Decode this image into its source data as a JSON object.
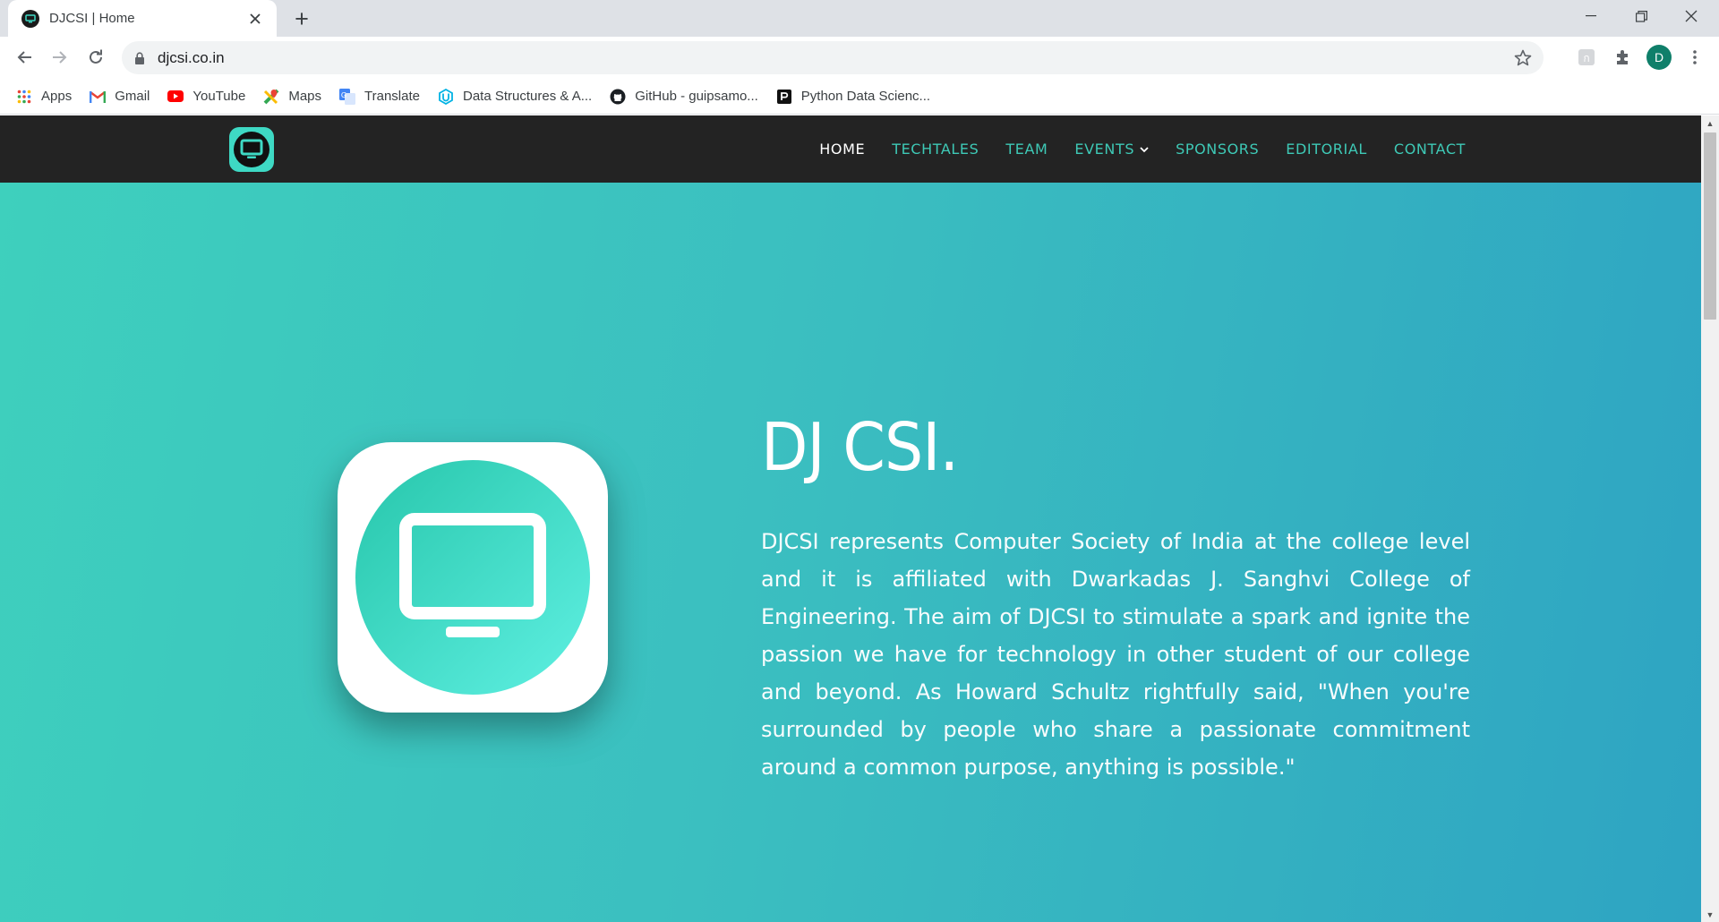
{
  "browser": {
    "tab": {
      "title": "DJCSI | Home",
      "close_glyph": "✕"
    },
    "new_tab_glyph": "+",
    "window_controls": {
      "minimize": "minimize-icon",
      "restore": "restore-icon",
      "close": "close-icon"
    },
    "url": "djcsi.co.in",
    "profile_initial": "D",
    "bookmarks": [
      {
        "label": "Apps",
        "icon": "apps-grid-icon"
      },
      {
        "label": "Gmail",
        "icon": "gmail-icon"
      },
      {
        "label": "YouTube",
        "icon": "youtube-icon"
      },
      {
        "label": "Maps",
        "icon": "maps-icon"
      },
      {
        "label": "Translate",
        "icon": "translate-icon"
      },
      {
        "label": "Data Structures & A...",
        "icon": "udacity-icon"
      },
      {
        "label": "GitHub - guipsamo...",
        "icon": "github-icon"
      },
      {
        "label": "Python Data Scienc...",
        "icon": "python-data-science-icon"
      }
    ]
  },
  "site": {
    "nav": {
      "items": [
        {
          "label": "HOME",
          "active": true
        },
        {
          "label": "TECHTALES",
          "active": false
        },
        {
          "label": "TEAM",
          "active": false
        },
        {
          "label": "EVENTS",
          "active": false,
          "dropdown": true
        },
        {
          "label": "SPONSORS",
          "active": false
        },
        {
          "label": "EDITORIAL",
          "active": false
        },
        {
          "label": "CONTACT",
          "active": false
        }
      ],
      "accent_color": "#3ec9b6",
      "background": "#232323"
    },
    "hero": {
      "title": "DJ CSI.",
      "text": "DJCSI represents Computer Society of India at the college level and it is affiliated with Dwarkadas J. Sanghvi College of Engineering. The aim of DJCSI to stimulate a spark and ignite the passion we have for technology in other student of our college and beyond. As Howard Schultz rightfully said, \"When you're surrounded by people who share a passionate commitment around a common purpose, anything is possible.\"",
      "gradient_start": "#3ed0bd",
      "gradient_end": "#2ea4c2"
    }
  }
}
